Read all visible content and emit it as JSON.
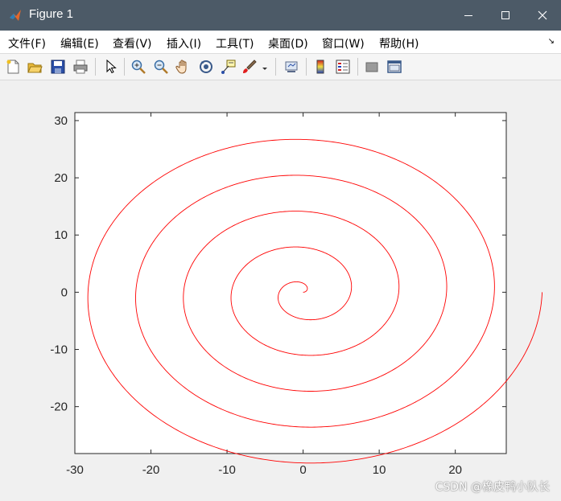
{
  "window": {
    "title": "Figure 1",
    "icon": "matlab-icon"
  },
  "menubar": {
    "items": [
      {
        "label": "文件(F)"
      },
      {
        "label": "编辑(E)"
      },
      {
        "label": "查看(V)"
      },
      {
        "label": "插入(I)"
      },
      {
        "label": "工具(T)"
      },
      {
        "label": "桌面(D)"
      },
      {
        "label": "窗口(W)"
      },
      {
        "label": "帮助(H)"
      }
    ]
  },
  "toolbar": {
    "icons": [
      "new-figure-icon",
      "open-file-icon",
      "save-icon",
      "print-icon",
      "select-arrow-icon",
      "zoom-in-icon",
      "zoom-out-icon",
      "pan-hand-icon",
      "rotate-3d-icon",
      "data-cursor-icon",
      "brush-icon",
      "brush-dropdown-icon",
      "link-plot-icon",
      "colorbar-icon",
      "legend-icon",
      "hide-plot-tools-icon",
      "show-plot-tools-icon"
    ]
  },
  "chart_data": {
    "type": "line",
    "description_series": "Archimedean spiral r = theta, x = theta*cos(theta), y = theta*sin(theta), theta from 0 to 10*pi",
    "theta_range": [
      0,
      31.4159
    ],
    "series": [
      {
        "color": "#ff0000"
      }
    ],
    "xlim": [
      -30,
      26.7
    ],
    "ylim": [
      -28.2,
      31.4
    ],
    "xticks": [
      "-30",
      "-20",
      "-10",
      "0",
      "10",
      "20"
    ],
    "yticks": [
      "-20",
      "-10",
      "0",
      "10",
      "20",
      "30"
    ],
    "grid": false,
    "title": "",
    "xlabel": "",
    "ylabel": ""
  },
  "watermark": "CSDN @橡皮鸭小队长",
  "colors": {
    "titlebar": "#4c5a67",
    "line": "#ff0000"
  }
}
